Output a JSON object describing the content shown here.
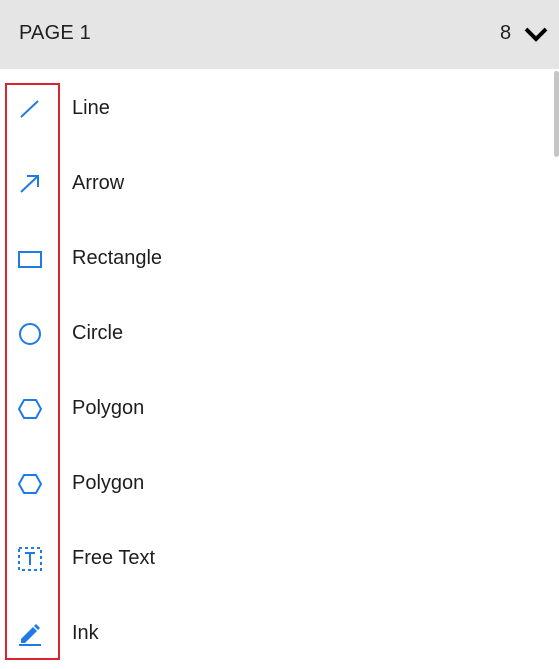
{
  "header": {
    "page_label": "PAGE 1",
    "count": "8",
    "toggle_icon": "chevron-down-icon"
  },
  "colors": {
    "icon": "#1e7be6",
    "highlight": "#d9232e",
    "header_bg": "#e5e5e5"
  },
  "items": [
    {
      "label": "Line",
      "icon": "line-icon"
    },
    {
      "label": "Arrow",
      "icon": "arrow-icon"
    },
    {
      "label": "Rectangle",
      "icon": "rectangle-icon"
    },
    {
      "label": "Circle",
      "icon": "circle-icon"
    },
    {
      "label": "Polygon",
      "icon": "polygon-icon"
    },
    {
      "label": "Polygon",
      "icon": "polygon-icon"
    },
    {
      "label": "Free Text",
      "icon": "free-text-icon"
    },
    {
      "label": "Ink",
      "icon": "ink-pen-icon"
    }
  ]
}
